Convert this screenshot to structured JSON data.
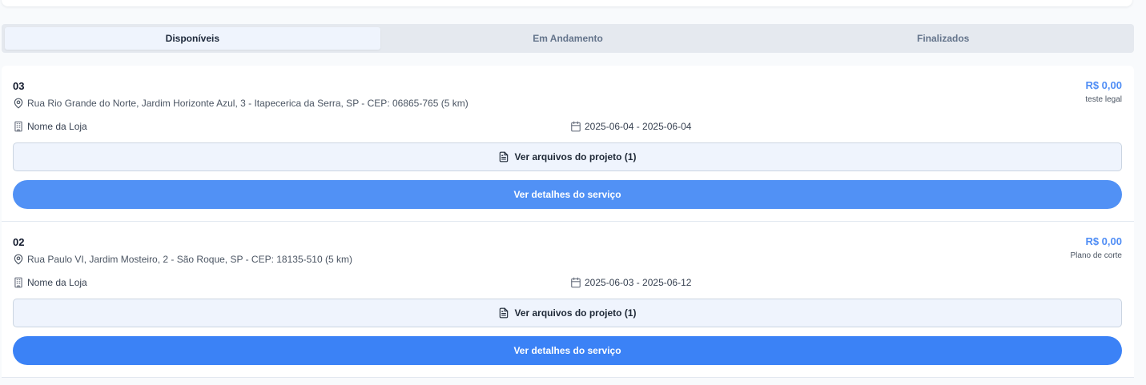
{
  "tabs": [
    {
      "label": "Disponíveis",
      "active": true
    },
    {
      "label": "Em Andamento",
      "active": false
    },
    {
      "label": "Finalizados",
      "active": false
    }
  ],
  "icons": {
    "address": "map-pin-icon",
    "store": "building-icon",
    "dates": "calendar-icon",
    "files": "file-text-icon"
  },
  "colors": {
    "accent": "#3b82f6",
    "price": "#4f8df5",
    "tab_background": "#e5e9ef",
    "active_tab": "#eff4fd"
  },
  "services": [
    {
      "number": "03",
      "address": "Rua Rio Grande do Norte, Jardim Horizonte Azul, 3 - Itapecerica da Serra, SP - CEP: 06865-765 (5 km)",
      "price": "R$ 0,00",
      "description": "teste legal",
      "store": "Nome da Loja",
      "dates": "2025-06-04 - 2025-06-04",
      "files_label": "Ver arquivos do projeto (1)",
      "details_label": "Ver detalhes do serviço"
    },
    {
      "number": "02",
      "address": "Rua Paulo VI, Jardim Mosteiro, 2 - São Roque, SP - CEP: 18135-510 (5 km)",
      "price": "R$ 0,00",
      "description": "Plano de corte",
      "store": "Nome da Loja",
      "dates": "2025-06-03 - 2025-06-12",
      "files_label": "Ver arquivos do projeto (1)",
      "details_label": "Ver detalhes do serviço"
    }
  ]
}
